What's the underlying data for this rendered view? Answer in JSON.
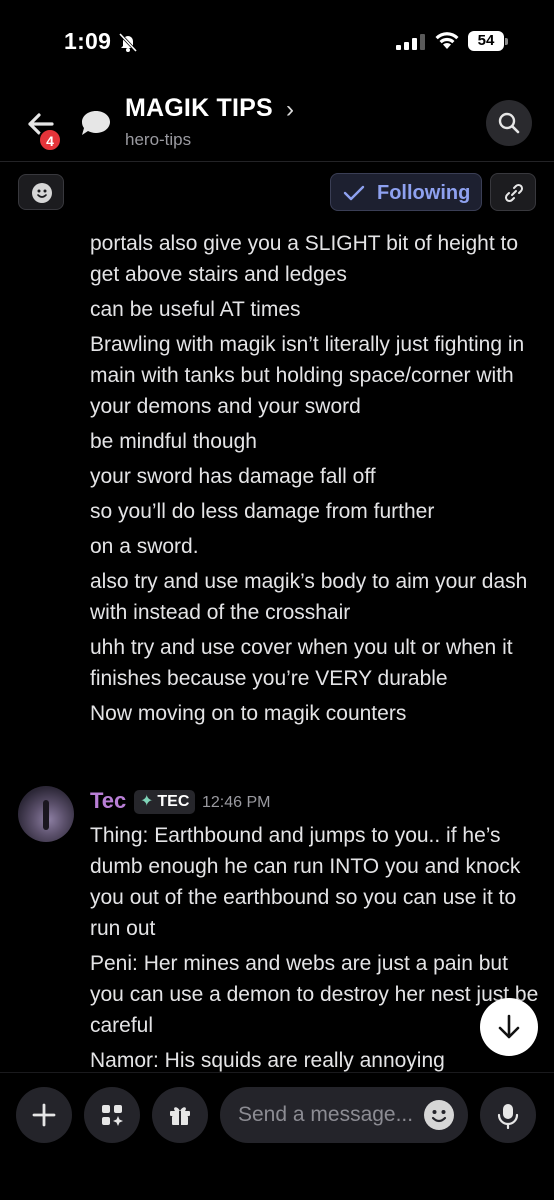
{
  "status_bar": {
    "time": "1:09",
    "battery": "54"
  },
  "header": {
    "unread_count": "4",
    "title": "MAGIK TIPS",
    "chevron": "›",
    "channel": "hero-tips"
  },
  "actions": {
    "following_label": "Following"
  },
  "messages": {
    "continued_lines": [
      "portals also give you a SLIGHT bit of height to get above stairs and ledges",
      "can be useful AT times",
      "Brawling with magik isn’t literally just fighting in main with tanks but holding space/corner with your demons and your sword",
      "be mindful though",
      "your sword has damage fall off",
      "so you’ll do less damage from further",
      "on a sword.",
      "also try and use magik’s body to aim your dash with instead of the crosshair",
      "uhh try and use cover when you ult or when it finishes because you’re VERY durable",
      "Now moving on to magik counters"
    ],
    "group": {
      "author": "Tec",
      "tag": "TEC",
      "timestamp": "12:46 PM",
      "lines": [
        "Thing: Earthbound and jumps to you.. if he’s dumb enough he can run INTO you and knock you out of the earthbound so you can use it to run out",
        "Peni: Her mines and webs are just a pain but you can use a demon to destroy her nest just be careful",
        "Namor: His squids are really annoying"
      ]
    }
  },
  "composer": {
    "placeholder": "Send a message..."
  },
  "colors": {
    "background": "#000000",
    "author": "#b97fd6",
    "following_text": "#8ea1f0",
    "badge": "#e5343a"
  }
}
